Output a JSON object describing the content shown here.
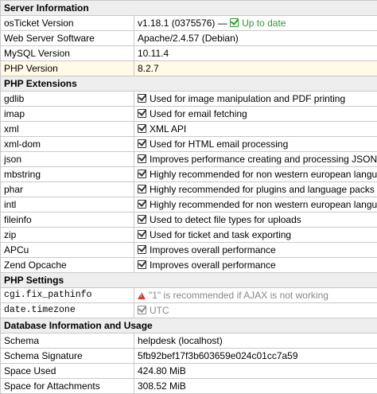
{
  "sections": {
    "server": {
      "title": "Server Information",
      "rows": [
        {
          "label": "osTicket Version",
          "value": "v1.18.1 (0375576) —",
          "status": "Up to date"
        },
        {
          "label": "Web Server Software",
          "value": "Apache/2.4.57 (Debian)"
        },
        {
          "label": "MySQL Version",
          "value": "10.11.4"
        },
        {
          "label": "PHP Version",
          "value": "8.2.7"
        }
      ]
    },
    "extensions": {
      "title": "PHP Extensions",
      "rows": [
        {
          "label": "gdlib",
          "value": "Used for image manipulation and PDF printing"
        },
        {
          "label": "imap",
          "value": "Used for email fetching"
        },
        {
          "label": "xml",
          "value": "XML API"
        },
        {
          "label": "xml-dom",
          "value": "Used for HTML email processing"
        },
        {
          "label": "json",
          "value": "Improves performance creating and processing JSON"
        },
        {
          "label": "mbstring",
          "value": "Highly recommended for non western european language content"
        },
        {
          "label": "phar",
          "value": "Highly recommended for plugins and language packs"
        },
        {
          "label": "intl",
          "value": "Highly recommended for non western european language content"
        },
        {
          "label": "fileinfo",
          "value": "Used to detect file types for uploads"
        },
        {
          "label": "zip",
          "value": "Used for ticket and task exporting"
        },
        {
          "label": "APCu",
          "value": "Improves overall performance"
        },
        {
          "label": "Zend Opcache",
          "value": "Improves overall performance"
        }
      ]
    },
    "settings": {
      "title": "PHP Settings",
      "rows": [
        {
          "label": "cgi.fix_pathinfo",
          "value": "\"1\" is recommended if AJAX is not working"
        },
        {
          "label": "date.timezone",
          "value": "UTC"
        }
      ]
    },
    "database": {
      "title": "Database Information and Usage",
      "rows": [
        {
          "label": "Schema",
          "value": "helpdesk (localhost)"
        },
        {
          "label": "Schema Signature",
          "value": "5fb92bef17f3b603659e024c01cc7a59"
        },
        {
          "label": "Space Used",
          "value": "424.80 MiB"
        },
        {
          "label": "Space for Attachments",
          "value": "308.52 MiB"
        }
      ]
    }
  },
  "icons": {
    "check": "check-square-icon",
    "warning": "warning-triangle-icon"
  },
  "colors": {
    "ok": "#2c9a2c",
    "warning": "#d13b3b",
    "muted": "#888888",
    "section_bg": "#eeeeee",
    "highlight_bg": "#fffbe6",
    "border": "#c8c8c8"
  }
}
